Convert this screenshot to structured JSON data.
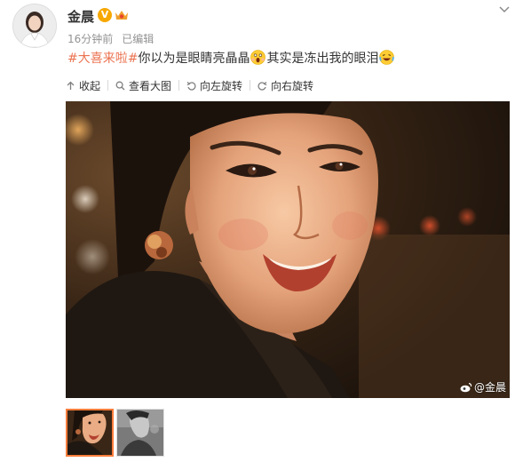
{
  "post": {
    "username": "金晨",
    "verified_badge": "V",
    "time": "16分钟前",
    "edited": "已编辑",
    "hashtag": "#大喜来啦#",
    "text_part1": "你以为是眼睛亮晶晶",
    "text_part2": "其实是冻出我的眼泪"
  },
  "toolbar": {
    "collapse_label": "收起",
    "view_large_label": "查看大图",
    "rotate_left_label": "向左旋转",
    "rotate_right_label": "向右旋转"
  },
  "photo": {
    "watermark": "@金晨"
  },
  "colors": {
    "hashtag": "#eb7350",
    "meta_text": "#939393",
    "thumb_selected_border": "#fa7d3c",
    "verified_badge": "#f7a800"
  },
  "icons": {
    "avatar": "avatar",
    "verified": "verified-badge-icon",
    "member": "member-icon",
    "menu": "chevron-down-icon",
    "emoji_1": "shocked-emoji-icon",
    "emoji_2": "laugh-cry-emoji-icon",
    "collapse": "collapse-icon",
    "zoom": "search-icon",
    "rotate_left": "rotate-left-icon",
    "rotate_right": "rotate-right-icon",
    "watermark": "weibo-icon"
  }
}
